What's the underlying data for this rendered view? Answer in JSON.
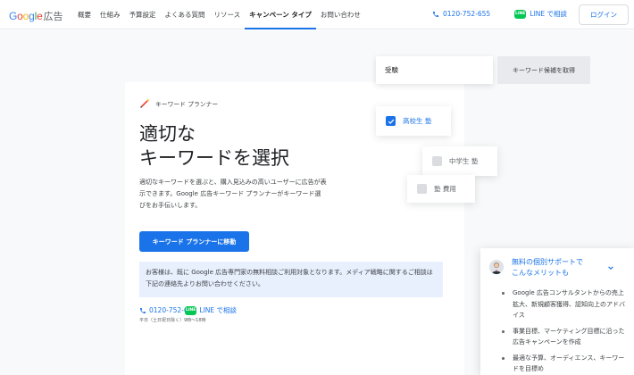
{
  "header": {
    "logo_google": "Google",
    "logo_ads": "広告",
    "nav": [
      "概要",
      "仕組み",
      "予算設定",
      "よくある質問",
      "リソース",
      "キャンペーン タイプ",
      "お問い合わせ"
    ],
    "active_nav": "キャンペーン タイプ",
    "phone": "0120-752-655",
    "line_label": "LINE で相談",
    "login": "ログイン"
  },
  "hero": {
    "eyebrow": "キーワード プランナー",
    "title_line1": "適切な",
    "title_line2": "キーワードを選択",
    "description": "適切なキーワードを選ぶと、購入見込みの高いユーザーに広告が表示できます。Google 広告キーワード プランナーがキーワード選びをお手伝いします。",
    "cta": "キーワード プランナーに移動"
  },
  "notice": {
    "text": "お客様は、既に Google 広告専門家の無料相談ご利用対象となります。メディア戦略に関するご相談は下記の連絡先よりお問い合わせください。"
  },
  "contact": {
    "phone": "0120-752-655",
    "line_label": "LINE で相談",
    "hours": "平日（土日祝日除く）9時〜18時"
  },
  "demo": {
    "search_value": "受験",
    "get_button": "キーワード候補を取得",
    "chips": [
      {
        "label": "高校生 塾",
        "checked": true
      },
      {
        "label": "中学生 塾",
        "checked": false
      },
      {
        "label": "塾 費用",
        "checked": false
      }
    ]
  },
  "support": {
    "title_line1": "無料の個別サポートで",
    "title_line2": "こんなメリットも",
    "items": [
      "Google 広告コンサルタントからの売上拡大、新規顧客獲得、認知向上のアドバイス",
      "事業目標、マーケティング目標に沿った広告キャンペーンを作成",
      "最適な予算、オーディエンス、キーワードを目標め"
    ]
  },
  "colors": {
    "accent": "#1a73e8",
    "line_green": "#06c755",
    "notice_bg": "#e8f0fe"
  }
}
